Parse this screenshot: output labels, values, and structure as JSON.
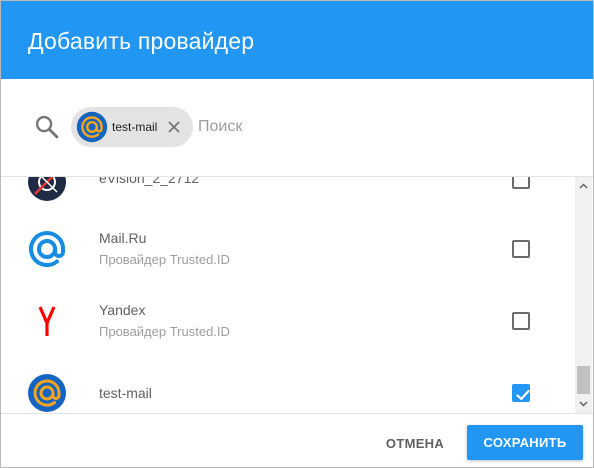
{
  "dialog": {
    "title": "Добавить провайдер"
  },
  "search": {
    "placeholder": "Поиск",
    "chip": {
      "label": "test-mail",
      "icon": "at-sign-icon"
    }
  },
  "providers": [
    {
      "name": "eVision_2_2712",
      "subtitle": "",
      "icon": "evision-logo-icon",
      "checked": false
    },
    {
      "name": "Mail.Ru",
      "subtitle": "Провайдер Trusted.ID",
      "icon": "mailru-logo-icon",
      "checked": false
    },
    {
      "name": "Yandex",
      "subtitle": "Провайдер Trusted.ID",
      "icon": "yandex-logo-icon",
      "checked": false
    },
    {
      "name": "test-mail",
      "subtitle": "",
      "icon": "at-sign-icon",
      "checked": true
    }
  ],
  "footer": {
    "cancel_label": "ОТМЕНА",
    "save_label": "СОХРАНИТЬ"
  },
  "colors": {
    "accent": "#2196f3",
    "yandex_red": "#ff0000",
    "mailru_blue": "#168de2",
    "testmail_orange": "#f7a31e"
  }
}
